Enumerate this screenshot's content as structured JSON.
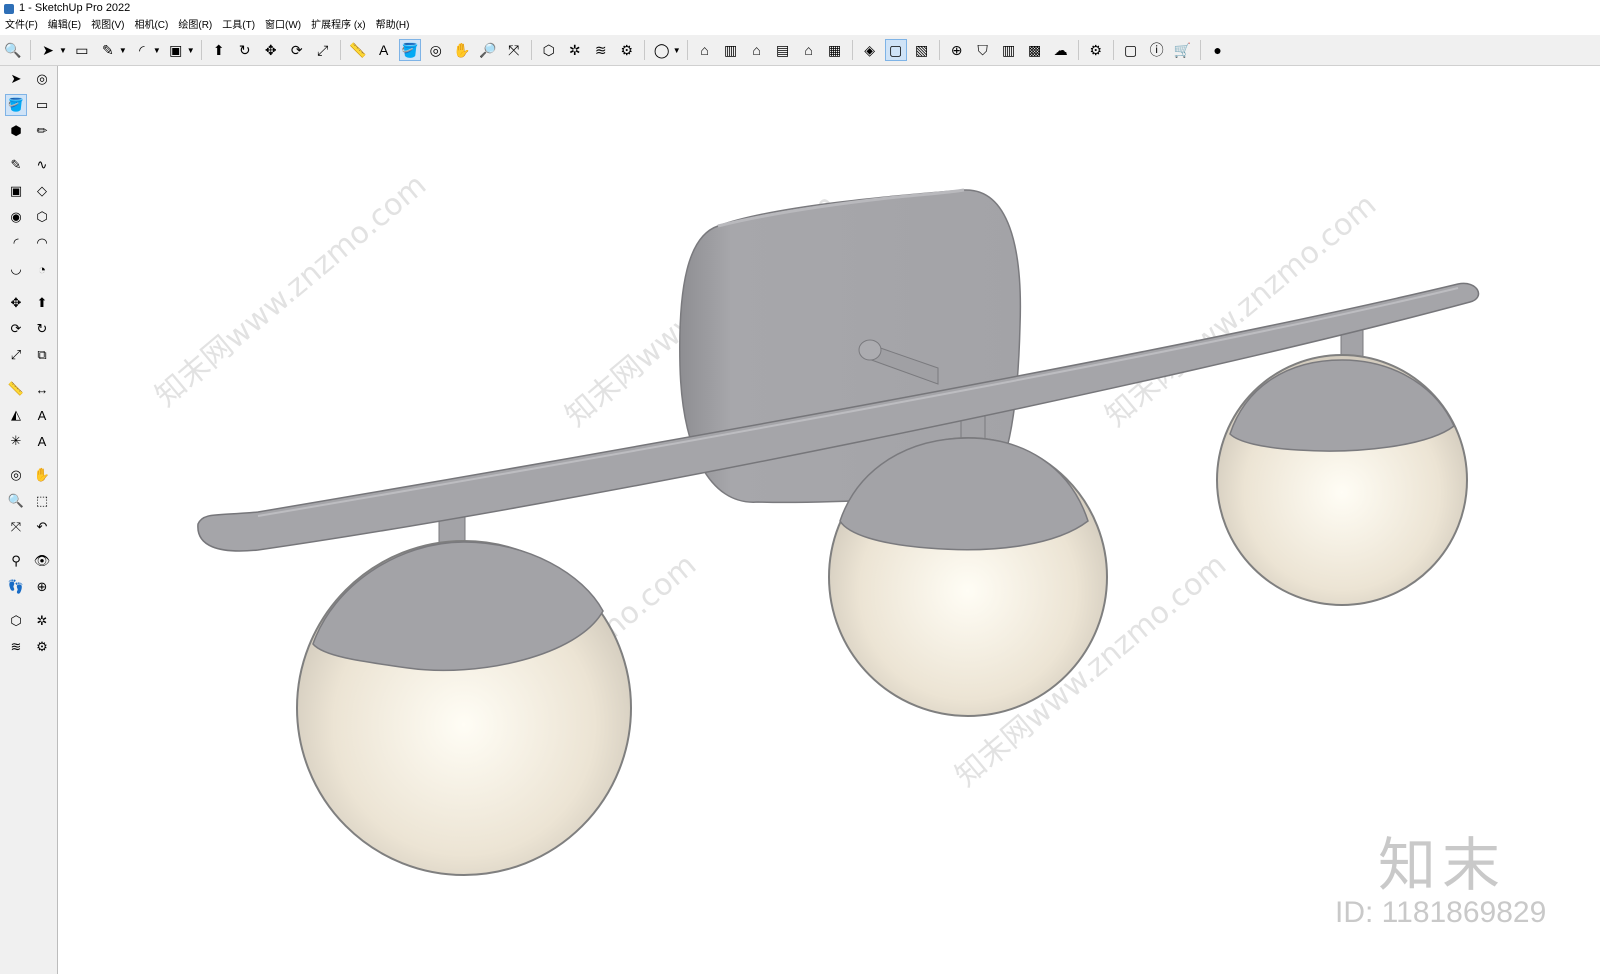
{
  "window": {
    "title": "1 - SketchUp Pro 2022"
  },
  "menu": [
    "文件(F)",
    "编辑(E)",
    "视图(V)",
    "相机(C)",
    "绘图(R)",
    "工具(T)",
    "窗口(W)",
    "扩展程序 (x)",
    "帮助(H)"
  ],
  "toolbar": {
    "icons": [
      "zoom-icon",
      "select-icon",
      "eraser-icon",
      "pencil-icon",
      "arc-icon",
      "rectangle-icon",
      "push-pull-icon",
      "follow-me-icon",
      "move-icon",
      "rotate-icon",
      "scale-icon",
      "tape-measure-icon",
      "text-icon",
      "paint-bucket-icon",
      "orbit-icon",
      "pan-icon",
      "zoom-tool-icon",
      "zoom-extents-icon",
      "3d-warehouse-icon",
      "extension-warehouse-icon",
      "layout-icon",
      "extension-manager-icon",
      "user-icon",
      "iso-view-icon",
      "front-view-icon",
      "home-icon",
      "right-view-icon",
      "back-view-icon",
      "left-view-icon",
      "solid-tools-icon",
      "outliner-icon",
      "scenes-icon",
      "add-location-icon",
      "geo-icon",
      "shadow-icon",
      "styles-icon",
      "cloud-icon",
      "settings-icon",
      "components-icon",
      "info-icon",
      "cart-icon",
      "account-icon"
    ]
  },
  "left_tools": [
    [
      "select-icon",
      "orbit-icon"
    ],
    [
      "paint-bucket-icon",
      "eraser-icon"
    ],
    [
      "component-icon",
      "tag-icon"
    ],
    [
      "pencil-icon",
      "freehand-icon"
    ],
    [
      "rectangle-icon",
      "rotated-rectangle-icon"
    ],
    [
      "circle-icon",
      "polygon-icon"
    ],
    [
      "arc-icon",
      "two-point-arc-icon"
    ],
    [
      "three-point-arc-icon",
      "pie-icon"
    ],
    [
      "move-icon",
      "push-pull-icon"
    ],
    [
      "rotate-icon",
      "follow-me-icon"
    ],
    [
      "scale-icon",
      "offset-icon"
    ],
    [
      "tape-measure-icon",
      "dimension-icon"
    ],
    [
      "protractor-icon",
      "text-icon"
    ],
    [
      "axes-icon",
      "3d-text-icon"
    ],
    [
      "orbit-icon",
      "pan-icon"
    ],
    [
      "zoom-icon",
      "zoom-window-icon"
    ],
    [
      "zoom-extents-icon",
      "previous-view-icon"
    ],
    [
      "position-camera-icon",
      "look-around-icon"
    ],
    [
      "walk-icon",
      "section-plane-icon"
    ],
    [
      "warehouse-icon",
      "extension-warehouse-icon"
    ],
    [
      "layout-icon",
      "extension-manager-icon"
    ]
  ],
  "overlay": {
    "watermark_text": "知末网www.znzmo.com",
    "brand_mark": "知末",
    "id_label": "ID: 1181869829"
  },
  "colors": {
    "metal": "#a3a3a7",
    "metal_dark": "#8c8c90",
    "glass": "#ede6d8",
    "glass_edge": "#8a8a8a"
  }
}
